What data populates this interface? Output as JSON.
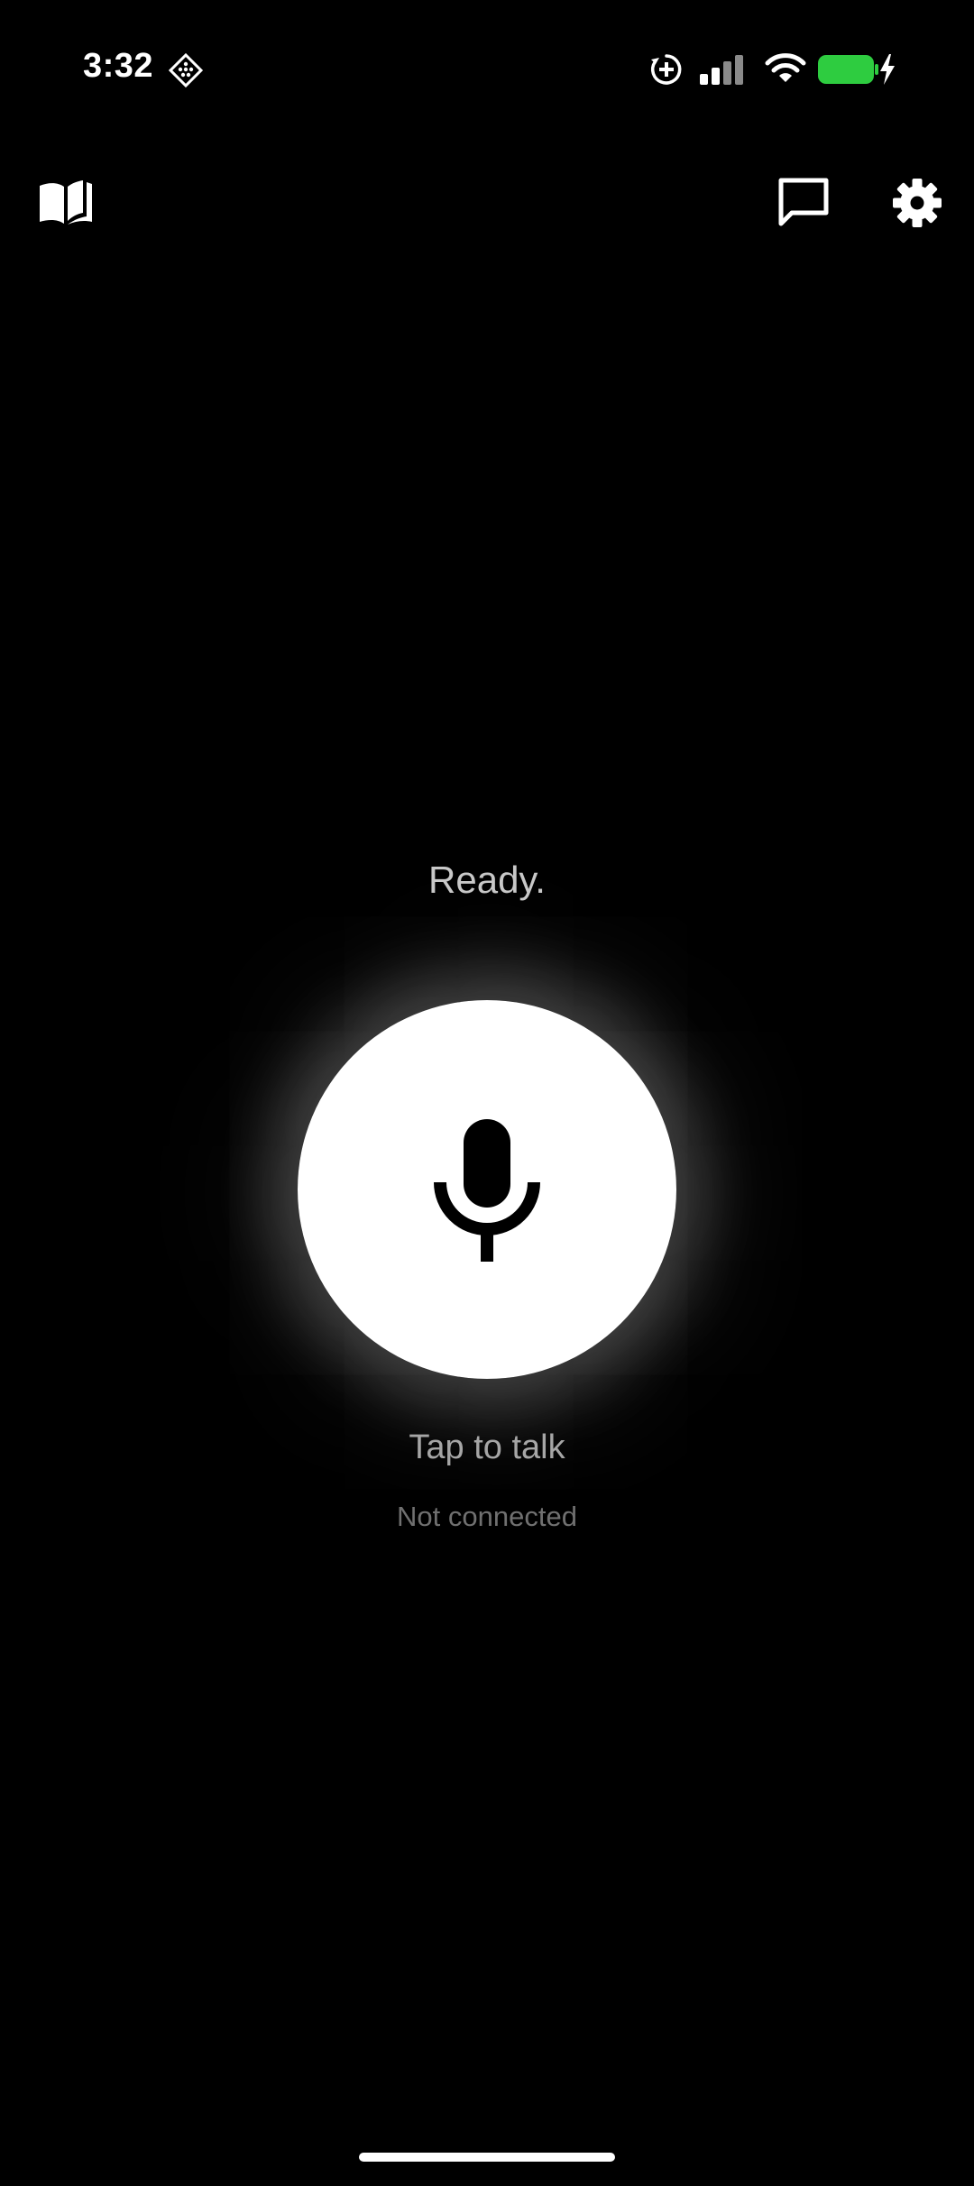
{
  "status_bar": {
    "time": "3:32",
    "icons": [
      "game-controller-icon",
      "orientation-lock-icon",
      "cellular-signal-icon",
      "wifi-icon",
      "battery-charging-icon"
    ],
    "battery_color": "#2ecc40"
  },
  "toolbar": {
    "left_icon": "book-open-icon",
    "right_icons": [
      "chat-bubble-icon",
      "gear-icon"
    ]
  },
  "main": {
    "status_text": "Ready.",
    "mic_icon": "microphone-icon",
    "action_label": "Tap to talk",
    "connection_status": "Not connected"
  },
  "colors": {
    "background": "#000000",
    "mic_button": "#ffffff",
    "status_text": "#c8c8c8",
    "action_label": "#a6a6a6",
    "connection_status": "#707070"
  }
}
